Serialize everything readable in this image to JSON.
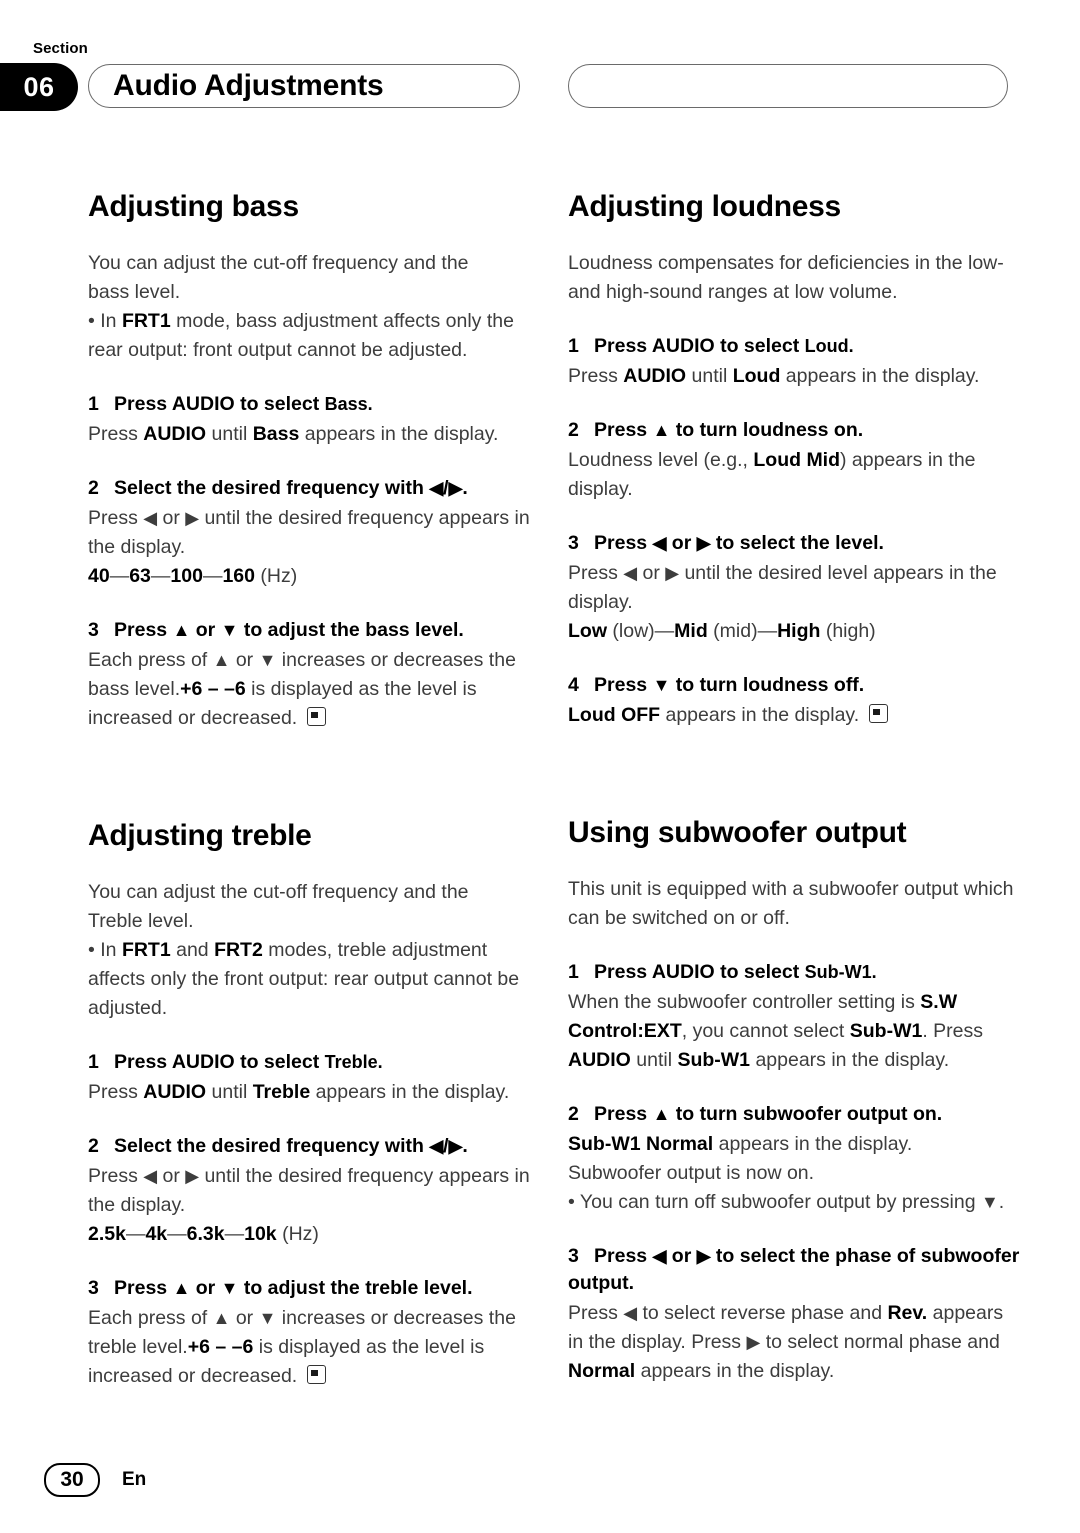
{
  "header": {
    "section_label": "Section",
    "section_number": "06",
    "title": "Audio Adjustments"
  },
  "footer": {
    "page_number": "30",
    "language": "En"
  },
  "left_column": {
    "sections": [
      {
        "title": "Adjusting bass",
        "intro": "You can adjust the cut-off frequency and the bass level.",
        "bullet": "• In FRT1 mode, bass adjustment affects only the rear output: front output cannot be adjusted.",
        "steps": [
          {
            "number": "1",
            "heading": "Press AUDIO to select Bass.",
            "body": "Press AUDIO until Bass appears in the display."
          },
          {
            "number": "2",
            "heading": "Select the desired frequency with ◀/▶.",
            "body": "Press ◀ or ▶ until the desired frequency appears in the display.",
            "values": "40—63—100—160 (Hz)"
          },
          {
            "number": "3",
            "heading": "Press ▲ or ▼ to adjust the bass level.",
            "body": "Each press of ▲ or ▼ increases or decreases the bass level. +6 – –6 is displayed as the level is increased or decreased."
          }
        ]
      },
      {
        "title": "Adjusting treble",
        "intro": "You can adjust the cut-off frequency and the Treble level.",
        "bullet": "• In FRT1 and FRT2 modes, treble adjustment affects only the front output: rear output cannot be adjusted.",
        "steps": [
          {
            "number": "1",
            "heading": "Press AUDIO to select Treble.",
            "body": "Press AUDIO until Treble appears in the display."
          },
          {
            "number": "2",
            "heading": "Select the desired frequency with ◀/▶.",
            "body": "Press ◀ or ▶ until the desired frequency appears in the display.",
            "values": "2.5k—4k—6.3k—10k (Hz)"
          },
          {
            "number": "3",
            "heading": "Press ▲ or ▼ to adjust the treble level.",
            "body": "Each press of ▲ or ▼ increases or decreases the treble level. +6 – –6 is displayed as the level is increased or decreased."
          }
        ]
      }
    ]
  },
  "right_column": {
    "sections": [
      {
        "title": "Adjusting loudness",
        "intro": "Loudness compensates for deficiencies in the low- and high-sound ranges at low volume.",
        "steps": [
          {
            "number": "1",
            "heading": "Press AUDIO to select Loud.",
            "body": "Press AUDIO until Loud appears in the display."
          },
          {
            "number": "2",
            "heading": "Press ▲ to turn loudness on.",
            "body": "Loudness level (e.g., Loud Mid) appears in the display."
          },
          {
            "number": "3",
            "heading": "Press ◀ or ▶ to select the level.",
            "body": "Press ◀ or ▶ until the desired level appears in the display.",
            "values": "Low (low)—Mid (mid)—High (high)"
          },
          {
            "number": "4",
            "heading": "Press ▼ to turn loudness off.",
            "body": "Loud OFF appears in the display."
          }
        ]
      },
      {
        "title": "Using subwoofer output",
        "intro": "This unit is equipped with a subwoofer output which can be switched on or off.",
        "steps": [
          {
            "number": "1",
            "heading": "Press AUDIO to select Sub-W1.",
            "body": "When the subwoofer controller setting is S.W Control:EXT, you cannot select Sub-W1. Press AUDIO until Sub-W1 appears in the display."
          },
          {
            "number": "2",
            "heading": "Press ▲ to turn subwoofer output on.",
            "body": "Sub-W1 Normal appears in the display. Subwoofer output is now on.",
            "bullet": "• You can turn off subwoofer output by pressing ▼."
          },
          {
            "number": "3",
            "heading": "Press ◀ or ▶ to select the phase of subwoofer output.",
            "body": "Press ◀ to select reverse phase and Rev. appears in the display. Press ▶ to select normal phase and Normal appears in the display."
          }
        ]
      }
    ]
  }
}
